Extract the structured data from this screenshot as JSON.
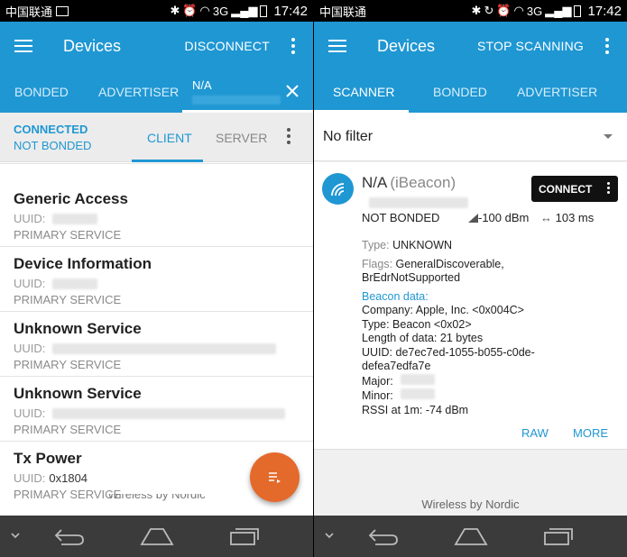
{
  "left": {
    "status": {
      "carrier": "中国联通",
      "network": "3G",
      "time": "17:42"
    },
    "appbar": {
      "title": "Devices",
      "action": "DISCONNECT"
    },
    "tabs": {
      "bonded": "BONDED",
      "advertiser": "ADVERTISER",
      "device": "N/A"
    },
    "connection": {
      "state": "CONNECTED",
      "bond": "NOT BONDED",
      "tab_client": "CLIENT",
      "tab_server": "SERVER"
    },
    "partial_type": "PRIMARY SERVICE",
    "services": [
      {
        "name": "Generic Access",
        "uuid_label": "UUID:",
        "uuid": "",
        "type": "PRIMARY SERVICE"
      },
      {
        "name": "Device Information",
        "uuid_label": "UUID:",
        "uuid": "",
        "type": "PRIMARY SERVICE"
      },
      {
        "name": "Unknown Service",
        "uuid_label": "UUID:",
        "uuid": "",
        "type": "PRIMARY SERVICE"
      },
      {
        "name": "Unknown Service",
        "uuid_label": "UUID:",
        "uuid": "",
        "type": "PRIMARY SERVICE"
      },
      {
        "name": "Tx Power",
        "uuid_label": "UUID:",
        "uuid": "0x1804",
        "type": "PRIMARY SERVICE"
      }
    ],
    "footer": "Wireless by Nordic"
  },
  "right": {
    "status": {
      "carrier": "中国联通",
      "network": "3G",
      "time": "17:42"
    },
    "appbar": {
      "title": "Devices",
      "action": "STOP SCANNING"
    },
    "tabs": {
      "scanner": "SCANNER",
      "bonded": "BONDED",
      "advertiser": "ADVERTISER"
    },
    "filter": "No filter",
    "device": {
      "name": "N/A",
      "kind": "(iBeacon)",
      "connect_label": "CONNECT",
      "bond": "NOT BONDED",
      "rssi": "-100 dBm",
      "interval": "103 ms",
      "type_label": "Type:",
      "type": "UNKNOWN",
      "flags_label": "Flags:",
      "flags_1": "GeneralDiscoverable,",
      "flags_2": "BrEdrNotSupported",
      "beacon_label": "Beacon data:",
      "company": "Company: Apple, Inc. <0x004C>",
      "btype": "Type: Beacon <0x02>",
      "length": "Length of data: 21 bytes",
      "uuid_1": "UUID: de7ec7ed-1055-b055-c0de-",
      "uuid_2": "defea7edfa7e",
      "major": "Major:",
      "minor": "Minor:",
      "rssi1m": "RSSI at 1m: -74 dBm",
      "raw": "RAW",
      "more": "MORE"
    },
    "footer": "Wireless by Nordic"
  },
  "colors": {
    "primary": "#1f97d3",
    "fab": "#e46a2c",
    "navbar": "#3b3b3b"
  },
  "icons": [
    "menu-icon",
    "more-vert-icon",
    "close-icon",
    "fab-action-icon",
    "beacon-icon",
    "signal-icon",
    "interval-icon",
    "back-icon",
    "home-icon",
    "recents-icon",
    "chevron-down-icon"
  ]
}
